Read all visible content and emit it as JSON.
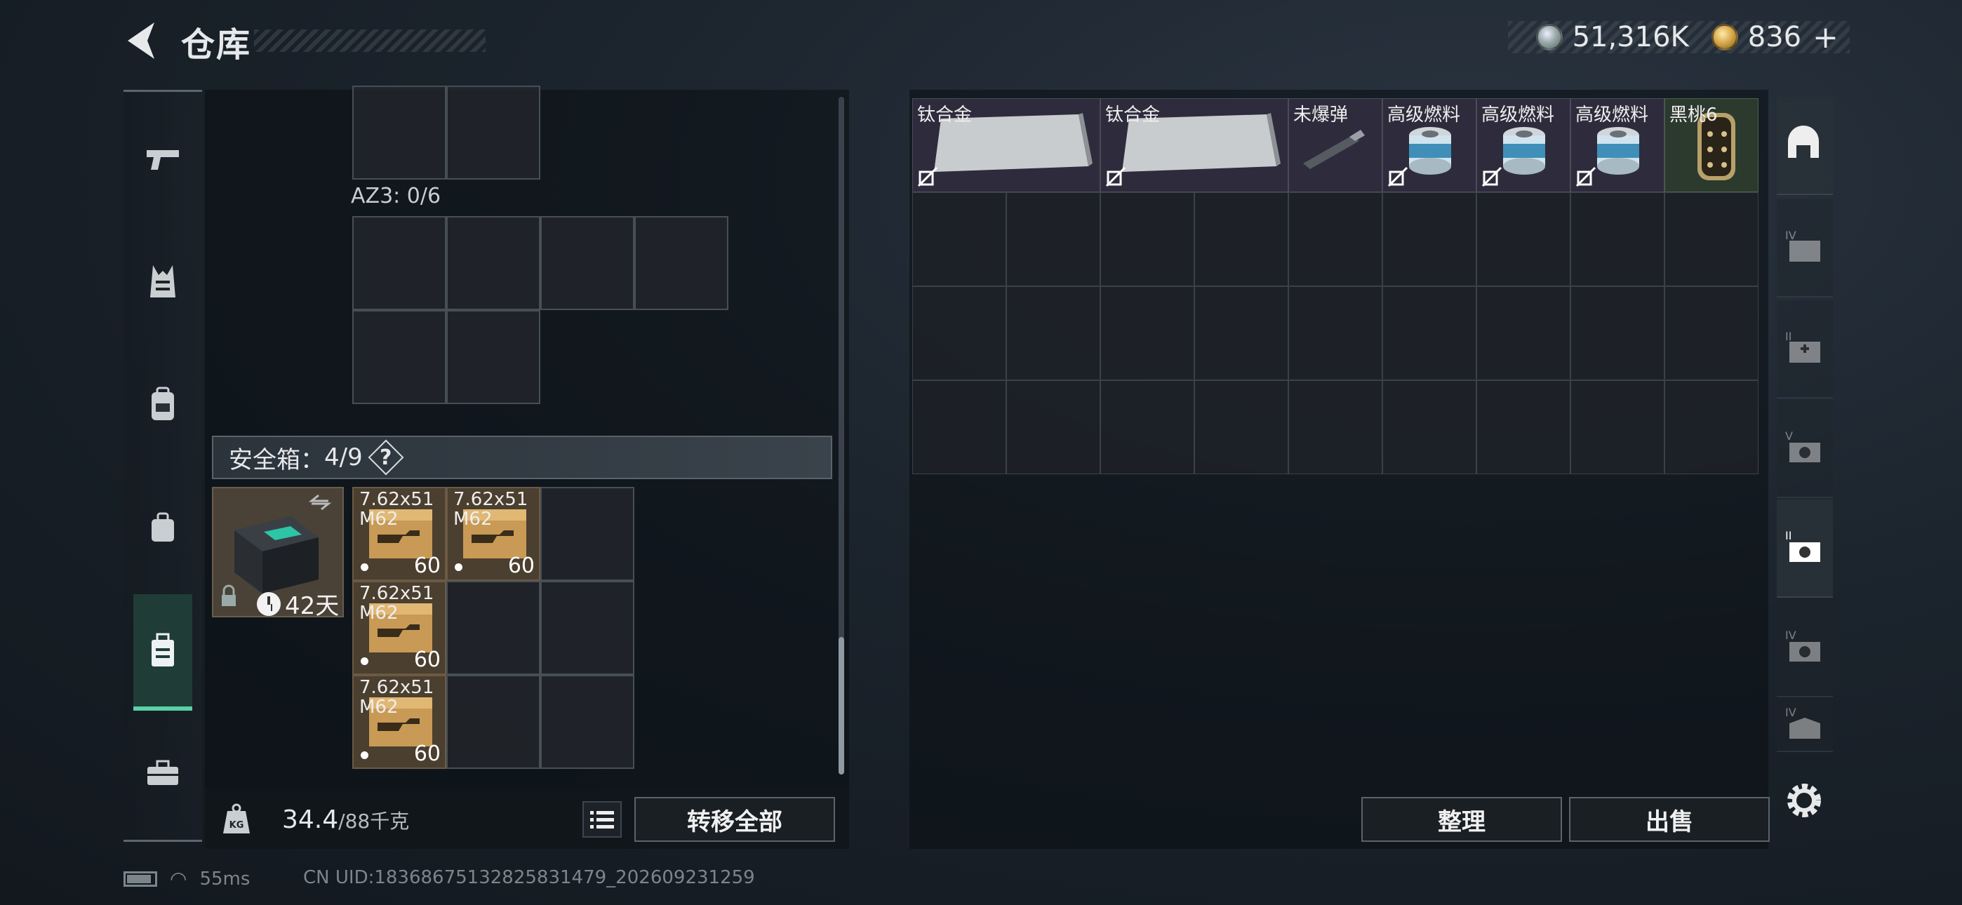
{
  "header": {
    "title": "仓库"
  },
  "currency": {
    "silver": "51,316K",
    "gold": "836",
    "plus": "+"
  },
  "sidebar": {
    "items": [
      {
        "icon": "pistol-icon"
      },
      {
        "icon": "vest-icon"
      },
      {
        "icon": "backpack-icon"
      },
      {
        "icon": "pouch-icon"
      },
      {
        "icon": "safe-case-icon",
        "active": true
      },
      {
        "icon": "toolbox-icon"
      }
    ]
  },
  "container": {
    "az3_label": "AZ3: 0/6"
  },
  "safe_box": {
    "header_label": "安全箱：",
    "header_count": "4/9",
    "help": "?",
    "days": "42天"
  },
  "ammo": [
    {
      "name": "7.62x51\nM62",
      "count": "60"
    },
    {
      "name": "7.62x51\nM62",
      "count": "60"
    },
    {
      "name": "7.62x51\nM62",
      "count": "60"
    },
    {
      "name": "7.62x51\nM62",
      "count": "60"
    }
  ],
  "weight": {
    "current": "34.4",
    "max": "/88千克"
  },
  "buttons": {
    "transfer_all": "转移全部",
    "organize": "整理",
    "sell": "出售"
  },
  "stash_items": [
    {
      "label": "钛合金",
      "type": "titanium"
    },
    {
      "label": "钛合金",
      "type": "titanium"
    },
    {
      "label": "未爆弹",
      "type": "dud"
    },
    {
      "label": "高级燃料",
      "type": "fuel"
    },
    {
      "label": "高级燃料",
      "type": "fuel"
    },
    {
      "label": "高级燃料",
      "type": "fuel"
    },
    {
      "label": "黑桃6",
      "type": "card"
    }
  ],
  "right_tabs": [
    {
      "icon": "stash-home-icon",
      "active": true
    },
    {
      "icon": "folder-iv-icon"
    },
    {
      "icon": "medkit-ii-icon"
    },
    {
      "icon": "camera-v-icon"
    },
    {
      "icon": "camera-key-icon",
      "active": true
    },
    {
      "icon": "camera-iv-icon"
    },
    {
      "icon": "bag-iv-icon"
    }
  ],
  "status": {
    "ping": "55ms",
    "uid": "CN UID:1836867513282583147​9_202609231259"
  }
}
